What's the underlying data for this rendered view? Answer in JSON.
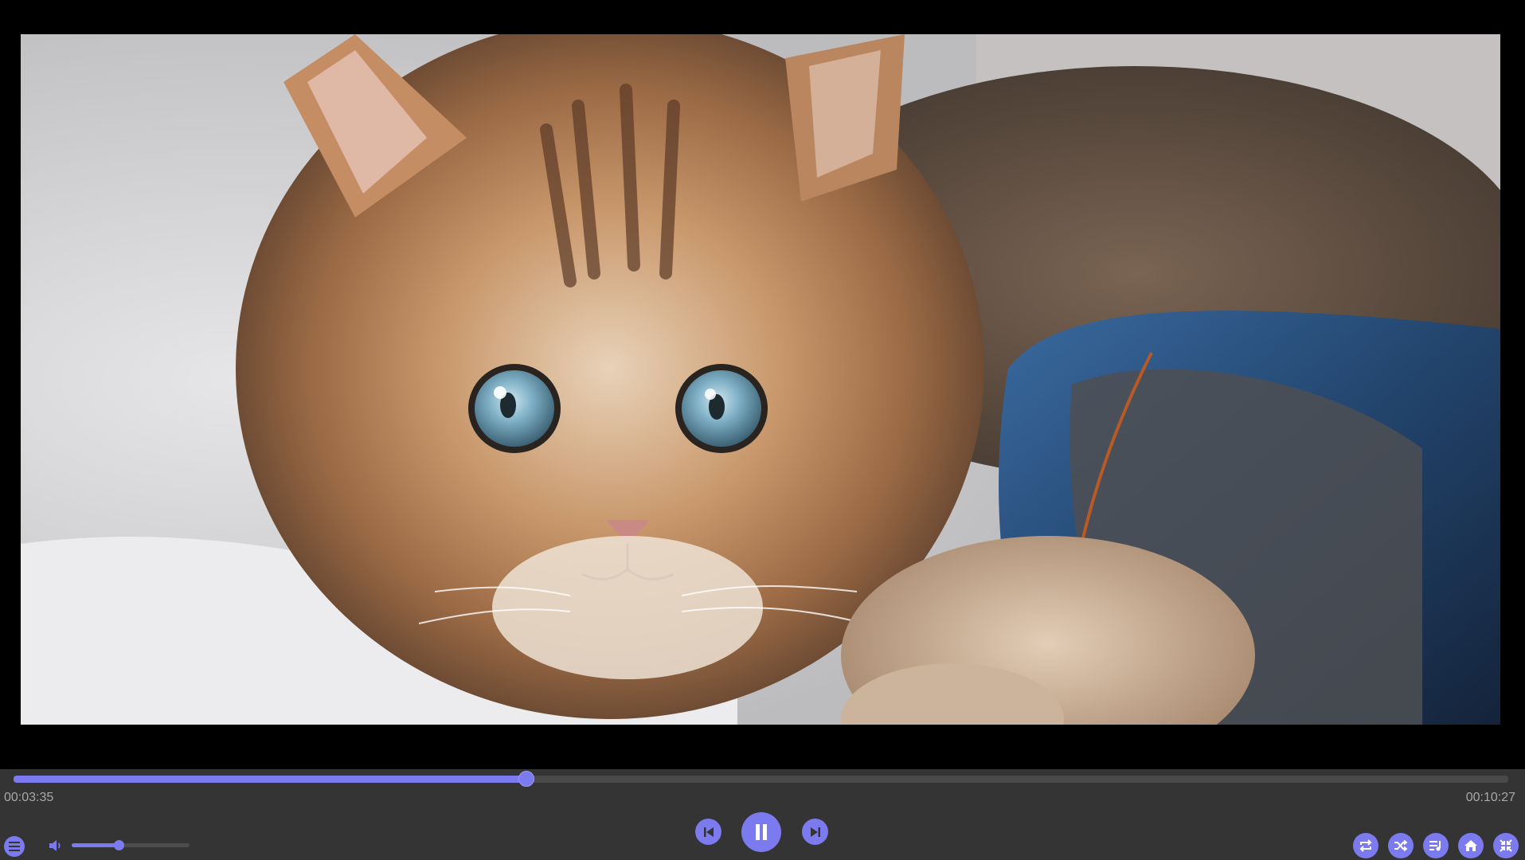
{
  "player": {
    "current_time": "00:03:35",
    "total_time": "00:10:27",
    "progress": 0.343,
    "volume": 0.4,
    "accent_color": "#7b7bef",
    "background_color": "#343434"
  },
  "icons": {
    "menu": "menu-icon",
    "volume": "volume-icon",
    "previous": "skip-previous-icon",
    "pause": "pause-icon",
    "next": "skip-next-icon",
    "repeat": "repeat-icon",
    "shuffle": "shuffle-icon",
    "playlist": "playlist-icon",
    "home": "home-icon",
    "exit_fullscreen": "exit-fullscreen-icon"
  }
}
